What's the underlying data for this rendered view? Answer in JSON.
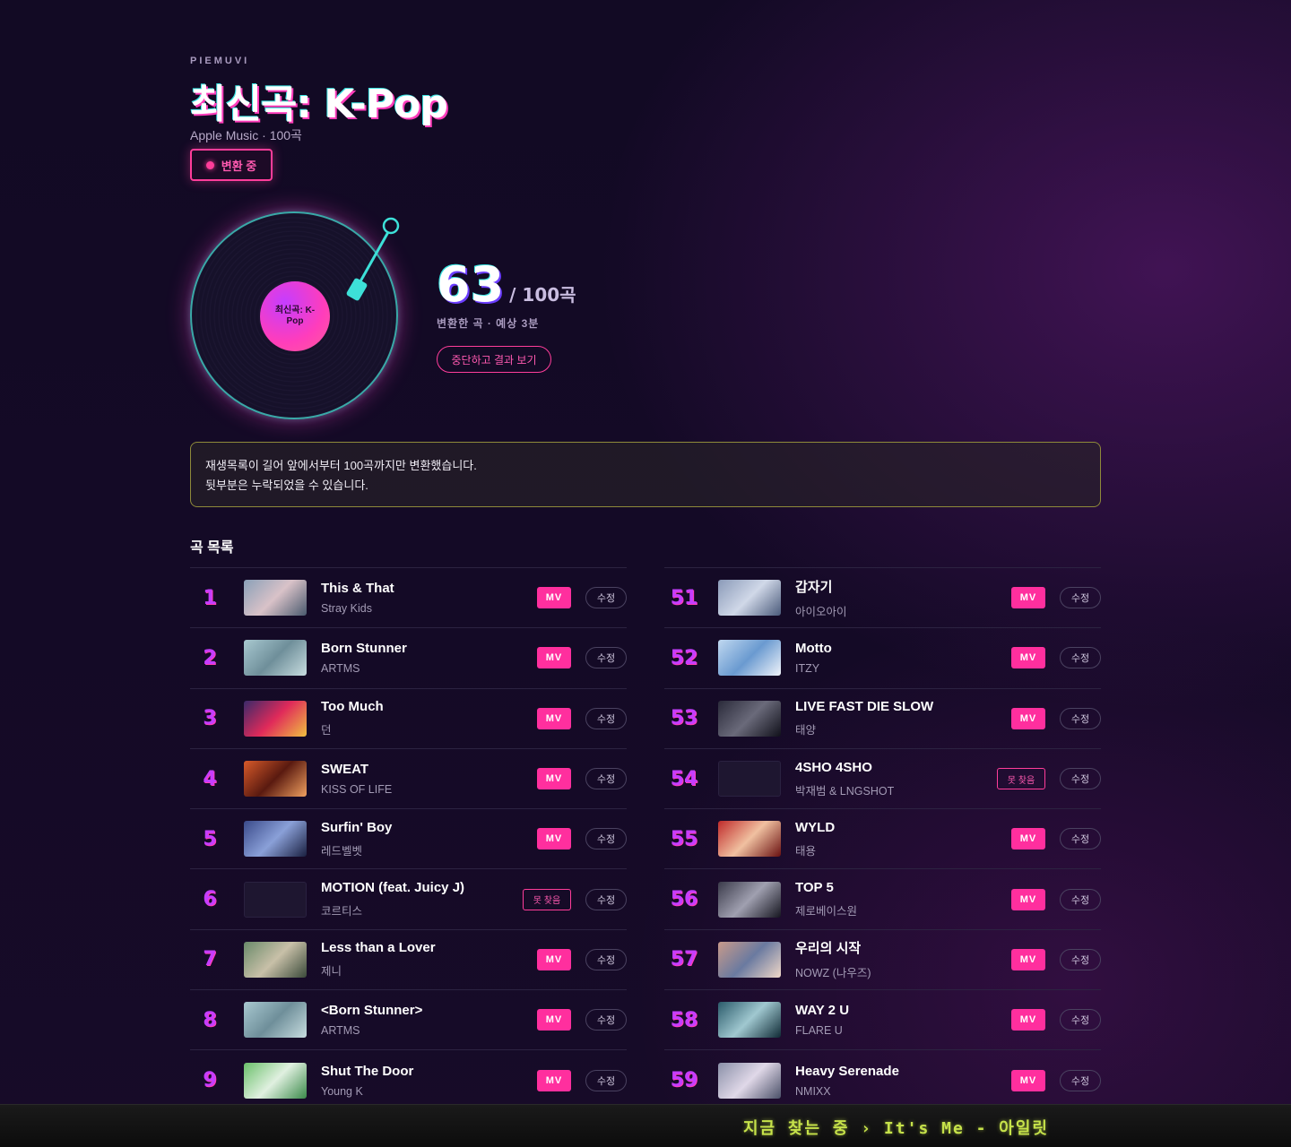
{
  "brand": "PIEMUVI",
  "title": "최신곡: K-Pop",
  "subtitle": "Apple Music · 100곡",
  "status_label": "변환 중",
  "vinyl_label": "최신곡: K-Pop",
  "progress": {
    "converted": "63",
    "total_text": "/ 100곡",
    "sub": "변환한 곡 · 예상 3분",
    "converted_fraction": 0.63
  },
  "stop_button": "중단하고 결과 보기",
  "notice": {
    "line1": "재생목록이 길어 앞에서부터 100곡까지만 변환했습니다.",
    "line2": "뒷부분은 누락되었을 수 있습니다."
  },
  "section_title": "곡 목록",
  "labels": {
    "mv": "MV",
    "not_found": "못 찾음",
    "edit": "수정"
  },
  "left_tracks": [
    {
      "num": "1",
      "title": "This & That",
      "artist": "Stray Kids",
      "found": true,
      "thumb": [
        "#8aa0b8",
        "#d9c2c8",
        "#4a5a6e"
      ]
    },
    {
      "num": "2",
      "title": "Born Stunner",
      "artist": "ARTMS",
      "found": true,
      "thumb": [
        "#a8c8d0",
        "#6f8f9a",
        "#c8dde0"
      ]
    },
    {
      "num": "3",
      "title": "Too Much",
      "artist": "던",
      "found": true,
      "thumb": [
        "#3a2a6a",
        "#e02a5a",
        "#f0c040"
      ]
    },
    {
      "num": "4",
      "title": "SWEAT",
      "artist": "KISS OF LIFE",
      "found": true,
      "thumb": [
        "#d85a2a",
        "#5a1a10",
        "#f0a060"
      ]
    },
    {
      "num": "5",
      "title": "Surfin' Boy",
      "artist": "레드벨벳",
      "found": true,
      "thumb": [
        "#3a4a8a",
        "#8aa0d8",
        "#1a2040"
      ]
    },
    {
      "num": "6",
      "title": "MOTION (feat. Juicy J)",
      "artist": "코르티스",
      "found": false,
      "thumb": []
    },
    {
      "num": "7",
      "title": "Less than a Lover",
      "artist": "제니",
      "found": true,
      "thumb": [
        "#6a8a6a",
        "#c8c0a8",
        "#3a4a3a"
      ]
    },
    {
      "num": "8",
      "title": "<Born Stunner>",
      "artist": "ARTMS",
      "found": true,
      "thumb": [
        "#a8c8d0",
        "#6f8f9a",
        "#c8dde0"
      ]
    },
    {
      "num": "9",
      "title": "Shut The Door",
      "artist": "Young K",
      "found": true,
      "thumb": [
        "#6ac06a",
        "#e0f0e0",
        "#3a8a4a"
      ]
    }
  ],
  "right_tracks": [
    {
      "num": "51",
      "title": "갑자기",
      "artist": "아이오아이",
      "found": true,
      "thumb": [
        "#8a9ab8",
        "#d0d8e8",
        "#4a5a7a"
      ]
    },
    {
      "num": "52",
      "title": "Motto",
      "artist": "ITZY",
      "found": true,
      "thumb": [
        "#c0d8f0",
        "#6a9ad0",
        "#f0f4fa"
      ]
    },
    {
      "num": "53",
      "title": "LIVE FAST DIE SLOW",
      "artist": "태양",
      "found": true,
      "thumb": [
        "#2a2a3a",
        "#6a6a7a",
        "#10101a"
      ]
    },
    {
      "num": "54",
      "title": "4SHO 4SHO",
      "artist": "박재범 & LNGSHOT",
      "found": false,
      "thumb": []
    },
    {
      "num": "55",
      "title": "WYLD",
      "artist": "태용",
      "found": true,
      "thumb": [
        "#c02a2a",
        "#f0c0a0",
        "#6a1010"
      ]
    },
    {
      "num": "56",
      "title": "TOP 5",
      "artist": "제로베이스원",
      "found": true,
      "thumb": [
        "#3a3a4a",
        "#a0a0b0",
        "#15151f"
      ]
    },
    {
      "num": "57",
      "title": "우리의 시작",
      "artist": "NOWZ (나우즈)",
      "found": true,
      "thumb": [
        "#c89a8a",
        "#6a7aa0",
        "#f0d8c8"
      ]
    },
    {
      "num": "58",
      "title": "WAY 2 U",
      "artist": "FLARE U",
      "found": true,
      "thumb": [
        "#2a5a6a",
        "#a0c8d0",
        "#0f2a35"
      ]
    },
    {
      "num": "59",
      "title": "Heavy Serenade",
      "artist": "NMIXX",
      "found": true,
      "thumb": [
        "#8a90a8",
        "#e0d8e8",
        "#4a5068"
      ]
    }
  ],
  "ticker": "지금 찾는 중 › It's Me - 아일릿"
}
